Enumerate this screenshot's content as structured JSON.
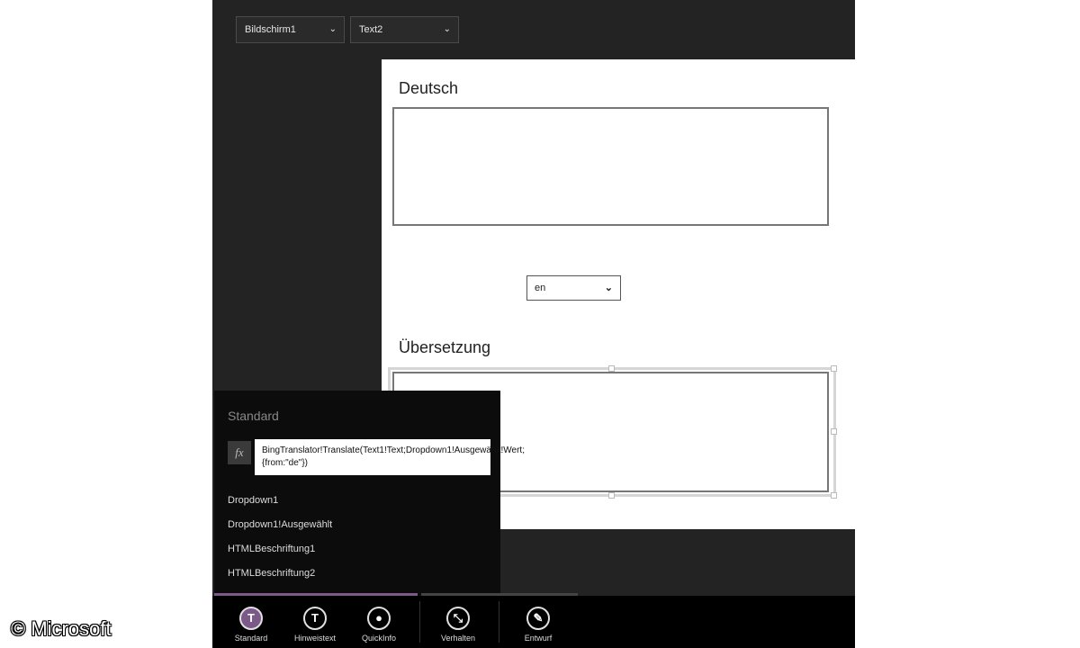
{
  "toolbar_top": {
    "screen_dropdown": "Bildschirm1",
    "control_dropdown": "Text2"
  },
  "canvas": {
    "label_german": "Deutsch",
    "language_value": "en",
    "label_translation": "Übersetzung"
  },
  "property_panel": {
    "title": "Standard",
    "fx_symbol": "fx",
    "formula": "BingTranslator!Translate(Text1!Text;Dropdown1!Ausgewählt!Wert;{from:\"de\"})",
    "suggestions": [
      "Dropdown1",
      "Dropdown1!Ausgewählt",
      "HTMLBeschriftung1",
      "HTMLBeschriftung2"
    ]
  },
  "bottom_bar": {
    "items": [
      {
        "label": "Standard",
        "icon": "T"
      },
      {
        "label": "Hinweistext",
        "icon": "T"
      },
      {
        "label": "QuickInfo",
        "icon": "●"
      },
      {
        "label": "Verhalten",
        "icon": "⤡"
      },
      {
        "label": "Entwurf",
        "icon": "✎"
      }
    ]
  },
  "copyright": "© Microsoft",
  "colors": {
    "accent": "#7b5a89",
    "background": "#232323"
  }
}
